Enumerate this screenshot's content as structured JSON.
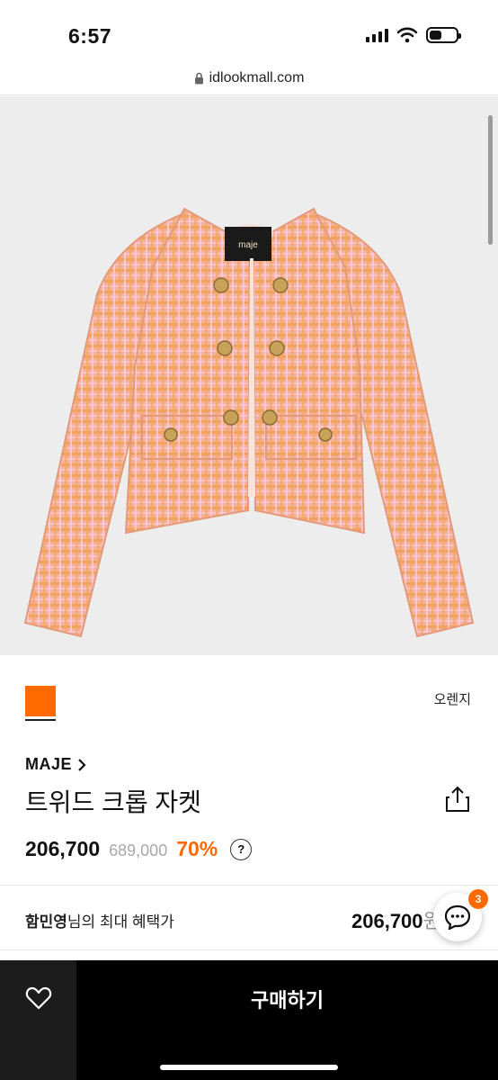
{
  "status": {
    "time": "6:57",
    "battery_level": 0.45
  },
  "browser": {
    "url": "idlookmall.com"
  },
  "product": {
    "image_label": "maje",
    "color_name": "오렌지",
    "color_hex": "#ff6a00",
    "brand": "MAJE",
    "title": "트위드 크롭 자켓",
    "price": "206,700",
    "original_price": "689,000",
    "discount": "70%",
    "help_label": "?"
  },
  "benefit": {
    "user_name": "함민영",
    "label_suffix": "님의 최대 혜택가",
    "price": "206,700",
    "unit": "원"
  },
  "chat": {
    "badge_count": "3"
  },
  "bottom_bar": {
    "buy_label": "구매하기"
  },
  "icons": [
    "lock-icon",
    "share-icon",
    "chevron-right-icon",
    "chat-icon",
    "heart-icon",
    "help-icon",
    "wifi-icon",
    "signal-icon",
    "battery-icon"
  ]
}
